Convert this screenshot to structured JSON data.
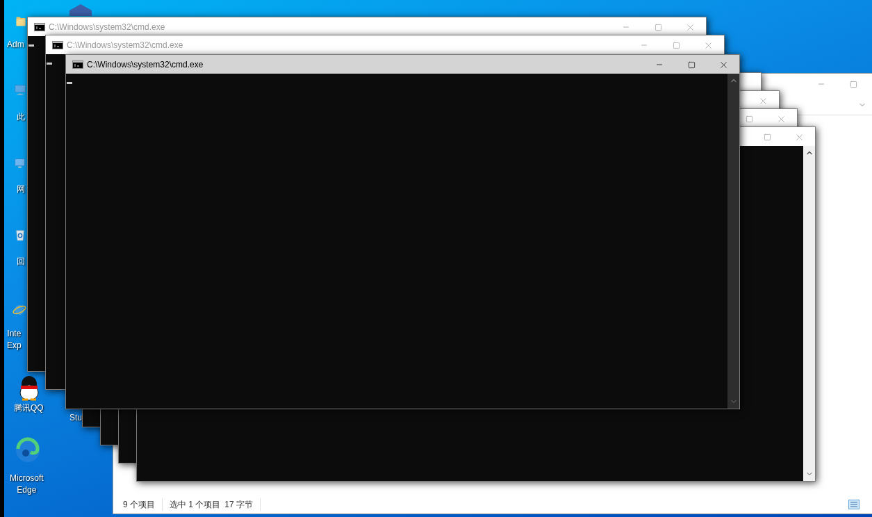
{
  "desktop_icons": [
    {
      "label": [
        "Adm"
      ]
    },
    {
      "label": [
        "此"
      ]
    },
    {
      "label": [
        "网"
      ]
    },
    {
      "label": [
        "回"
      ]
    },
    {
      "label": [
        "Inte",
        "Exp"
      ]
    },
    {
      "label": [
        "腾讯QQ"
      ]
    },
    {
      "label": [
        "Stu"
      ]
    },
    {
      "label": [
        "Microsoft",
        "Edge"
      ]
    }
  ],
  "cmd_windows": [
    {
      "title": "C:\\Windows\\system32\\cmd.exe",
      "active": false
    },
    {
      "title": "C:\\Windows\\system32\\cmd.exe",
      "active": false
    },
    {
      "title": "C:\\Windows\\system32\\cmd.exe",
      "active": true
    },
    {
      "active": false
    },
    {
      "active": false
    },
    {
      "active": false
    },
    {
      "active": false
    }
  ],
  "explorer": {
    "status_bar": [
      "9 个项目",
      "选中 1 个项目",
      "17 字节"
    ]
  }
}
